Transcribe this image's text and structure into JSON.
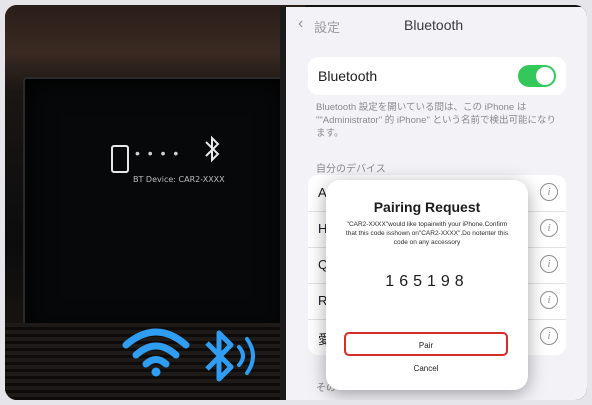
{
  "car": {
    "bt_device_label": "BT Device: CAR2-XXXX",
    "connecting_dots": "• • • •",
    "bluetooth_symbol": "ᛒ"
  },
  "settings": {
    "back_label": "設定",
    "title": "Bluetooth",
    "toggle_label": "Bluetooth",
    "toggle_on": true,
    "description": "Bluetooth 設定を開いている間は、この iPhone は \"\"Administrator\" 的 iPhone\" という名前で検出可能になります。",
    "my_devices_header": "自分のデバイス",
    "devices": [
      {
        "name": "AUT"
      },
      {
        "name": "HAY"
      },
      {
        "name": "Q M"
      },
      {
        "name": "Rec"
      },
      {
        "name": "愛鉄"
      }
    ],
    "other_header": "その"
  },
  "dialog": {
    "title": "Pairing Request",
    "message": "\"CAR2-XXXX\"would like topairwith your iPhone.Confirm that this code isshown on\"CAR2-XXXX\".Do notenter this code on any accessory",
    "code": "165198",
    "pair_label": "Pair",
    "cancel_label": "Cancel"
  },
  "colors": {
    "toggle_green": "#34c759",
    "highlight_red": "#d62b2b",
    "bluetooth_blue": "#2f9df2"
  }
}
